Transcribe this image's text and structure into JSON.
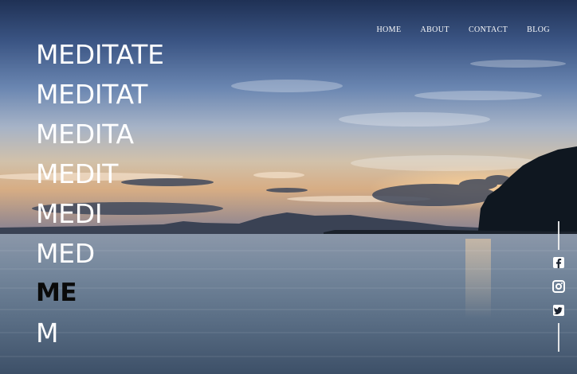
{
  "nav": {
    "items": [
      "HOME",
      "ABOUT",
      "CONTACT",
      "BLOG"
    ]
  },
  "hero": {
    "words": [
      "MEDITATE",
      "MEDITAT",
      "MEDITA",
      "MEDIT",
      "MEDI",
      "MED",
      "ME",
      "M"
    ],
    "highlight_index": 6
  },
  "social": {
    "icons": [
      "facebook-icon",
      "instagram-icon",
      "twitter-icon"
    ]
  },
  "colors": {
    "text": "#ffffff",
    "highlight": "#0a0a0a",
    "sky_top": "#24385f",
    "sky_horizon": "#d9b68f",
    "water": "#5e7389"
  }
}
